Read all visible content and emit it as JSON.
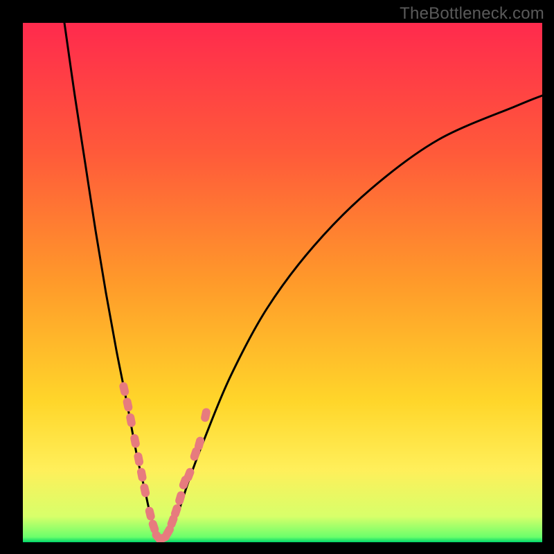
{
  "watermark": {
    "text": "TheBottleneck.com"
  },
  "colors": {
    "frame": "#000000",
    "curve": "#000000",
    "marker_fill": "#e77b7e",
    "gradient": [
      "#ff2a4d",
      "#ff5a3a",
      "#ff9a2a",
      "#ffd62a",
      "#ffef5a",
      "#d8ff6a",
      "#6bff6b",
      "#00d66a"
    ]
  },
  "chart_data": {
    "type": "line",
    "title": "",
    "xlabel": "",
    "ylabel": "",
    "xlim": [
      0,
      100
    ],
    "ylim": [
      0,
      100
    ],
    "grid": false,
    "legend": false,
    "series": [
      {
        "name": "bottleneck-curve-left",
        "x": [
          8,
          10,
          12,
          14,
          16,
          18,
          20,
          22,
          23.5,
          24.5,
          25.5,
          26.5
        ],
        "y": [
          100,
          86,
          73,
          60,
          48,
          37,
          27,
          16.5,
          10,
          5.5,
          2.5,
          0.5
        ]
      },
      {
        "name": "bottleneck-curve-right",
        "x": [
          27.5,
          28.5,
          30,
          32,
          35,
          40,
          47,
          56,
          67,
          80,
          95,
          100
        ],
        "y": [
          0.5,
          2.5,
          6,
          12,
          20,
          32,
          45,
          57,
          68,
          77.5,
          84,
          86
        ]
      }
    ],
    "markers": {
      "name": "highlighted-points",
      "shape": "rounded-capsule",
      "x": [
        19.5,
        20.2,
        20.8,
        21.6,
        22.3,
        22.9,
        23.5,
        24.5,
        25.2,
        26.0,
        27.0,
        28.0,
        28.8,
        29.5,
        30.3,
        31.1,
        32.0,
        33.2,
        34.0,
        35.2
      ],
      "y": [
        29.5,
        26.5,
        23.5,
        19.5,
        16.0,
        13.0,
        10.0,
        5.5,
        3.0,
        1.0,
        0.8,
        2.0,
        4.0,
        6.0,
        8.5,
        11.5,
        13.0,
        17.0,
        19.0,
        24.5
      ]
    }
  }
}
